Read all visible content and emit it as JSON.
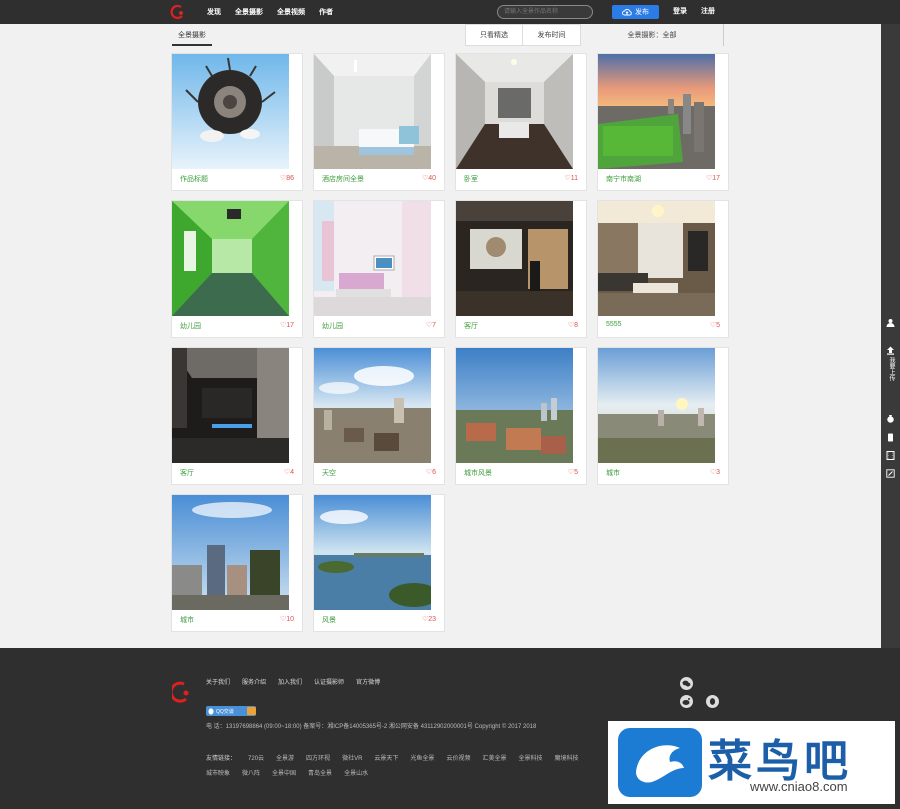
{
  "nav": {
    "items": [
      "发现",
      "全景摄影",
      "全景视频",
      "作者"
    ],
    "search_placeholder": "请输入全景作品名称",
    "publish_label": "发布",
    "login_label": "登录",
    "register_label": "注册"
  },
  "tabs": {
    "main": "全景摄影",
    "filter_1": "只看精选",
    "filter_2": "发布时间",
    "filter_3": "全景摄影：全部"
  },
  "cards": [
    {
      "title": "作品标题",
      "likes": "♡86"
    },
    {
      "title": "酒店房间全景",
      "likes": "♡40"
    },
    {
      "title": "卧室",
      "likes": "♡11"
    },
    {
      "title": "南宁市南湖",
      "likes": "♡17"
    },
    {
      "title": "幼儿园",
      "likes": "♡17"
    },
    {
      "title": "幼儿园",
      "likes": "♡7"
    },
    {
      "title": "客厅",
      "likes": "♡8"
    },
    {
      "title": "5555",
      "likes": "♡5"
    },
    {
      "title": "客厅",
      "likes": "♡4"
    },
    {
      "title": "天空",
      "likes": "♡6"
    },
    {
      "title": "城市风景",
      "likes": "♡5"
    },
    {
      "title": "城市",
      "likes": "♡3"
    },
    {
      "title": "城市",
      "likes": "♡10"
    },
    {
      "title": "风景",
      "likes": "♡23"
    }
  ],
  "sidebar": {
    "items": [
      {
        "icon": "user-icon",
        "label": ""
      },
      {
        "icon": "upload-icon",
        "label": "我要上传"
      },
      {
        "icon": "moneybag-icon",
        "label": ""
      },
      {
        "icon": "phone-icon",
        "label": ""
      },
      {
        "icon": "film-icon",
        "label": ""
      },
      {
        "icon": "edit-icon",
        "label": ""
      }
    ]
  },
  "footer": {
    "links": [
      "关于我们",
      "服务介绍",
      "加入我们",
      "认证摄影师",
      "官方微博"
    ],
    "qq_label": "QQ交谈",
    "info": "电 话：13197698864 (09:00~18:00) 备案号：湘ICP备14005365号-2 湘公网安备 43112902000001号     Copyright © 2017 2018",
    "friends_label": "友情链接：",
    "friends": [
      "720云",
      "全景游",
      "四方环视",
      "微社VR",
      "云景天下",
      "光鱼全景",
      "云价视频",
      "汇美全景",
      "全景科技",
      "魔境科技",
      "城市映象",
      "微八阵",
      "全景中国",
      "青岛全景",
      "全景山水"
    ]
  },
  "watermark": {
    "text": "菜鸟吧",
    "url": "www.cniao8.com"
  },
  "colors": {
    "accent": "#2b7ce6",
    "title_green": "#3b9c3b",
    "likes_red": "#d9534f",
    "topbar": "#2f2f2f"
  }
}
